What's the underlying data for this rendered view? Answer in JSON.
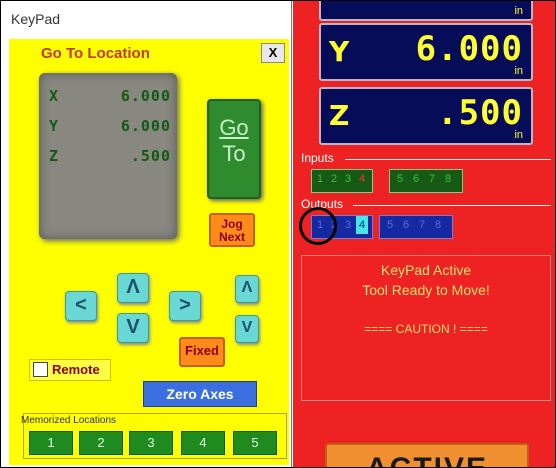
{
  "keypad_window": {
    "title": "KeyPad",
    "goto_title": "Go To Location",
    "close_label": "X",
    "display": [
      {
        "axis": "X",
        "value": "6.000"
      },
      {
        "axis": "Y",
        "value": "6.000"
      },
      {
        "axis": "Z",
        "value": ".500"
      }
    ],
    "go_top": "Go",
    "go_bottom": "To",
    "jog_line1": "Jog",
    "jog_line2": "Next",
    "arrows": {
      "left": "<",
      "up": "Λ",
      "right": ">",
      "down": "V",
      "z_up": "Λ",
      "z_down": "V"
    },
    "fixed_label": "Fixed",
    "remote_label": "Remote",
    "zero_axes_label": "Zero Axes",
    "memorized": {
      "title": "Memorized Locations",
      "buttons": [
        "1",
        "2",
        "3",
        "4",
        "5"
      ]
    }
  },
  "main_panel": {
    "dro": [
      {
        "axis": "",
        "value": "",
        "unit": "in"
      },
      {
        "axis": "Y",
        "value": "6.000",
        "unit": "in"
      },
      {
        "axis": "Z",
        "value": ".500",
        "unit": "in"
      }
    ],
    "inputs_label": "Inputs",
    "inputs": [
      "1",
      "2",
      "3",
      "4",
      "5",
      "6",
      "7",
      "8"
    ],
    "outputs_label": "Outputs",
    "outputs": [
      "1",
      "2",
      "3",
      "4",
      "5",
      "6",
      "7",
      "8"
    ],
    "messages": {
      "line1": "KeyPad Active",
      "line2": "Tool Ready to Move!",
      "line3": "==== CAUTION ! ===="
    },
    "active_label": "ACTIVE"
  },
  "colors": {
    "keypad_bg": "#ffff00",
    "main_bg": "#ee2222",
    "dro_bg": "#070c58",
    "dro_text": "#ffff30",
    "input_on": "#165a16",
    "output_on": "#152aa0",
    "highlight_output": "#45e6e6"
  }
}
